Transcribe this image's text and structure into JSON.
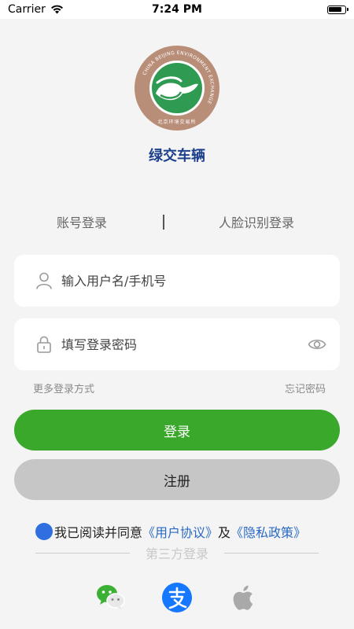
{
  "status_bar": {
    "carrier": "Carrier",
    "time": "7:24 PM"
  },
  "logo": {
    "ring_text": "CHINA BEIJING ENVIRONMENT EXCHANGE",
    "inner_text": "北京环境交易所"
  },
  "app_name": "绿交车辆",
  "login_tabs": {
    "account": "账号登录",
    "face": "人脸识别登录"
  },
  "username": {
    "placeholder": "输入用户名/手机号",
    "value": ""
  },
  "password": {
    "placeholder": "填写登录密码",
    "value": ""
  },
  "links": {
    "more_login": "更多登录方式",
    "forgot": "忘记密码"
  },
  "buttons": {
    "login": "登录",
    "register": "注册"
  },
  "agreement": {
    "prefix": "我已阅读并同意",
    "user_agreement": "《用户协议》",
    "and": "及",
    "privacy_policy": "《隐私政策》"
  },
  "third_party": {
    "title": "第三方登录"
  },
  "colors": {
    "accent_green": "#3aa82a",
    "app_name_blue": "#1b3f8a",
    "link_blue": "#2a6ac4",
    "checkbox_blue": "#2f6fe0",
    "register_gray": "#c6c6c6",
    "logo_ring": "#b98e79"
  },
  "icons": {
    "status": [
      "wifi-icon",
      "battery-icon"
    ],
    "fields": [
      "user-icon",
      "lock-icon",
      "eye-icon"
    ],
    "social": [
      "wechat-icon",
      "alipay-icon",
      "apple-icon"
    ]
  }
}
